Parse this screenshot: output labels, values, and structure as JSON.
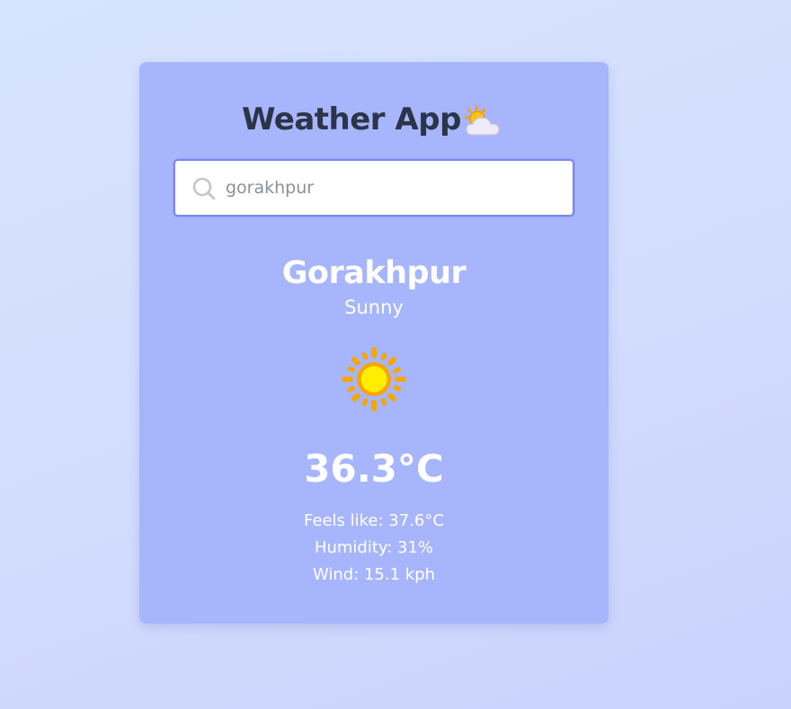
{
  "app": {
    "title": "Weather App",
    "title_icon": "sun-behind-cloud-icon"
  },
  "search": {
    "value": "gorakhpur",
    "placeholder": "",
    "icon": "search-icon"
  },
  "weather": {
    "city": "Gorakhpur",
    "condition": "Sunny",
    "condition_icon": "sun-icon",
    "temperature": "36.3°C",
    "feels_like": "Feels like: 37.6°C",
    "humidity": "Humidity: 31%",
    "wind": "Wind: 15.1 kph"
  },
  "colors": {
    "background": "#d4dffd",
    "card": "#a7b5fc",
    "title_text": "#2c3448",
    "search_border": "#7c87f0",
    "sun": "#ffe600",
    "sun_rays": "#f7a600"
  }
}
